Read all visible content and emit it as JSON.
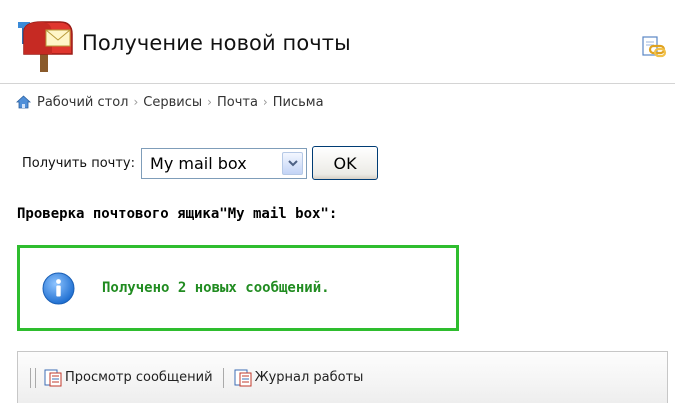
{
  "header": {
    "title": "Получение новой почты",
    "icons": {
      "app": "mailbox-icon",
      "action": "link-icon"
    }
  },
  "breadcrumb": {
    "home_icon": "home-icon",
    "items": [
      "Рабочий стол",
      "Сервисы",
      "Почта",
      "Письма"
    ],
    "separator": "›"
  },
  "fetch": {
    "label": "Получить почту:",
    "selected_mailbox": "My mail box",
    "ok_label": "OK"
  },
  "check": {
    "heading": "Проверка почтового ящика\"My mail box\":"
  },
  "info": {
    "icon": "info-icon",
    "message": "Получено 2 новых сообщений.",
    "border_color": "#2ebd2e",
    "text_color": "#218c21"
  },
  "toolbar": {
    "items": [
      {
        "label": "Просмотр сообщений",
        "icon": "document-list-icon"
      },
      {
        "label": "Журнал работы",
        "icon": "document-list-icon"
      }
    ]
  }
}
